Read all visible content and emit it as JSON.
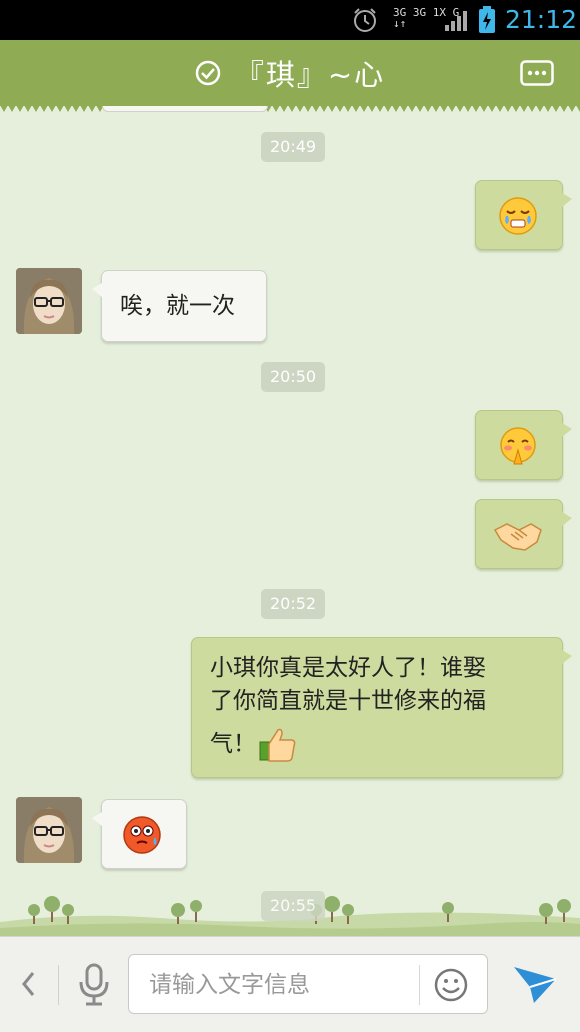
{
  "status_bar": {
    "network_line1": "3G 3G 1X G",
    "network_line2": "↓↑",
    "time": "21:12"
  },
  "header": {
    "title": "『琪』~心"
  },
  "messages": {
    "time_1": "20:49",
    "out_1_emoji": "crying-face-icon",
    "in_1_text": "唉，就一次",
    "time_2": "20:50",
    "out_2_emoji": "shy-pleading-face-icon",
    "out_3_emoji": "handshake-icon",
    "time_3": "20:52",
    "out_4_line1": "小琪你真是太好人了！谁娶",
    "out_4_line2": "了你简直就是十世修来的福",
    "out_4_line3": "气！",
    "out_4_emoji": "thumbs-up-icon",
    "in_2_emoji": "embarrassed-sweat-face-icon",
    "time_4": "20:55"
  },
  "input": {
    "placeholder": "请输入文字信息",
    "value": ""
  },
  "colors": {
    "header_bg": "#8fac55",
    "chat_bg": "#e6efdc",
    "out_bubble": "#cddc9e",
    "in_bubble": "#f6f6f2",
    "status_time": "#3fb7e8",
    "send_icon": "#2f8fd6"
  }
}
